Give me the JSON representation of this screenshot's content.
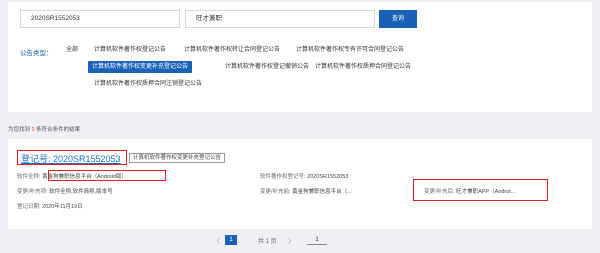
{
  "search": {
    "registration_no": "2020SR1552053",
    "software_name": "旺才兼职",
    "button": "查询"
  },
  "filters": {
    "label": "公告类型：",
    "items": [
      "全部",
      "计算机软件著作权登记公告",
      "计算机软件著作权转让合同登记公告",
      "计算机软件著作权专有许可合同登记公告",
      "计算机软件著作权变更补充登记公告",
      "计算机软件著作权登记撤销公告",
      "计算机软件著作权质押合同登记公告",
      "计算机软件著作权质押合同注销登记公告"
    ],
    "active": "计算机软件著作权变更补充登记公告"
  },
  "result": {
    "prefix": "为您找到",
    "count": "1",
    "suffix": "条符合条件的结果"
  },
  "card": {
    "reg_no": "登记号: 2020SR1552053",
    "tag": "计算机软件著作权变更补充登记公告",
    "full_name_label": "软件全称:",
    "full_name_value": "黄金狗兼职信息平台（Android版）",
    "cert_no_label": "软件著作权登记号:",
    "cert_no_value": "2020SR1552053",
    "change_item_label": "变更/补充项:",
    "change_item_value": "软件全称,软件简称,版本号",
    "before_label": "变更/补充前:",
    "before_value": "黄金狗兼职信息平台（...",
    "after_label": "变更/补充后:",
    "after_value": "旺才兼职APP（Androi...",
    "date_label": "登记日期:",
    "date_value": "2020年11月19日"
  },
  "pagination": {
    "prev": "〈",
    "current": "1",
    "total": "共 1 页",
    "next": "〉",
    "goto_value": "1"
  }
}
